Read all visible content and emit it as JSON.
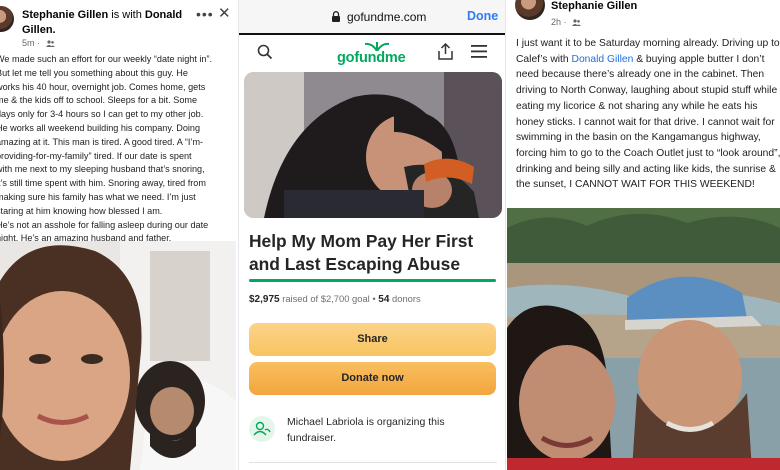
{
  "left_post": {
    "author": "Stephanie Gillen",
    "with_text": "is with",
    "tagged": "Donald Gillen.",
    "time": "5m",
    "audience": "Friends",
    "more": "•••",
    "close": "✕",
    "body": "We made such an effort for our weekly “date night in”.\nBut let me tell you something about this guy. He\nworks his 40 hour, overnight job. Comes home, gets\nme & the kids off to school. Sleeps for a bit. Some\ndays only for 3-4 hours so I can get to my other job.\nHe works all weekend building his company. Doing\namazing at it. This man is tired. A good tired. A “I’m-\nproviding-for-my-family” tired. If our date is spent\nwith me next to my sleeping husband that’s snoring,\nit’s still time spent with him. Snoring away, tired from\nmaking sure his family has what we need. I’m just\nstaring at him knowing how blessed I am.\nHe’s not an asshole for falling asleep during our date\nnight. He’s an amazing husband and father."
  },
  "browser": {
    "url": "gofundme.com",
    "done_label": "Done"
  },
  "gofundme": {
    "logo_text": "gofundme",
    "title": "Help My Mom Pay Her First and Last Escaping Abuse",
    "raised": "$2,975",
    "raised_suffix": "raised of $2,700 goal",
    "donors_count": "54",
    "donors_label": "donors",
    "progress_fraction": 1.0,
    "share_label": "Share",
    "donate_label": "Donate now",
    "organizer_text": "Michael Labriola is organizing this fundraiser.",
    "accent_color": "#02a95c"
  },
  "right_post": {
    "author": "Stephanie Gillen",
    "time": "2h",
    "body_before_mention": "I just want it to be Saturday morning already. Driving up to Calef’s with ",
    "mention": "Donald Gillen",
    "body_after_mention": " & buying apple butter I don’t need because there’s already one in the cabinet. Then driving to North Conway, laughing about stupid stuff while eating my licorice & not sharing any while he eats his honey sticks. I cannot wait for that drive. I cannot wait for swimming in the basin on the Kangamangus highway, forcing him to go to the Coach Outlet just to “look around”, drinking and being silly and acting like kids, the sunrise & the sunset, I CANNOT WAIT FOR THIS WEEKEND!"
  }
}
